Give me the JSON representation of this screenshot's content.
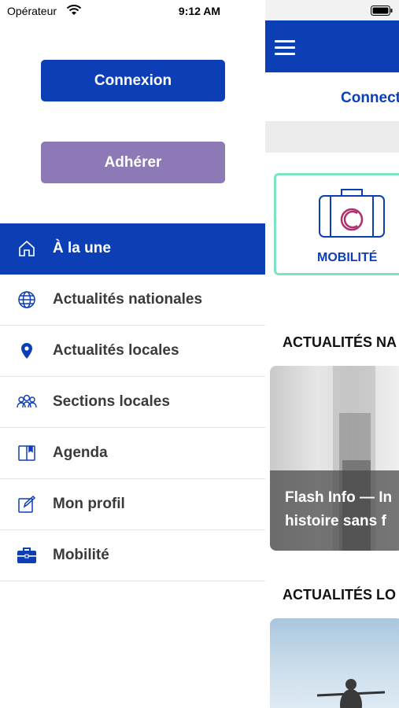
{
  "status_bar": {
    "carrier": "Opérateur",
    "time": "9:12 AM"
  },
  "drawer": {
    "connexion_label": "Connexion",
    "adherer_label": "Adhérer",
    "menu": [
      {
        "label": "À la une",
        "icon": "home-icon",
        "active": true
      },
      {
        "label": "Actualités nationales",
        "icon": "globe-icon"
      },
      {
        "label": "Actualités locales",
        "icon": "location-pin-icon"
      },
      {
        "label": "Sections locales",
        "icon": "people-icon"
      },
      {
        "label": "Agenda",
        "icon": "book-icon"
      },
      {
        "label": "Mon profil",
        "icon": "edit-icon"
      },
      {
        "label": "Mobilité",
        "icon": "briefcase-icon"
      }
    ]
  },
  "main": {
    "connect_text": "Connect",
    "mobility_label": "MOBILITÉ",
    "section_national": "ACTUALITÉS NA",
    "section_local": "ACTUALITÉS LO",
    "news_caption_line1": "Flash Info — In",
    "news_caption_line2": "histoire sans f"
  },
  "colors": {
    "primary": "#0c3fb5",
    "adherer": "#8c79b5",
    "mobility_border": "#7de3c4",
    "mobility_accent": "#b0306e"
  }
}
